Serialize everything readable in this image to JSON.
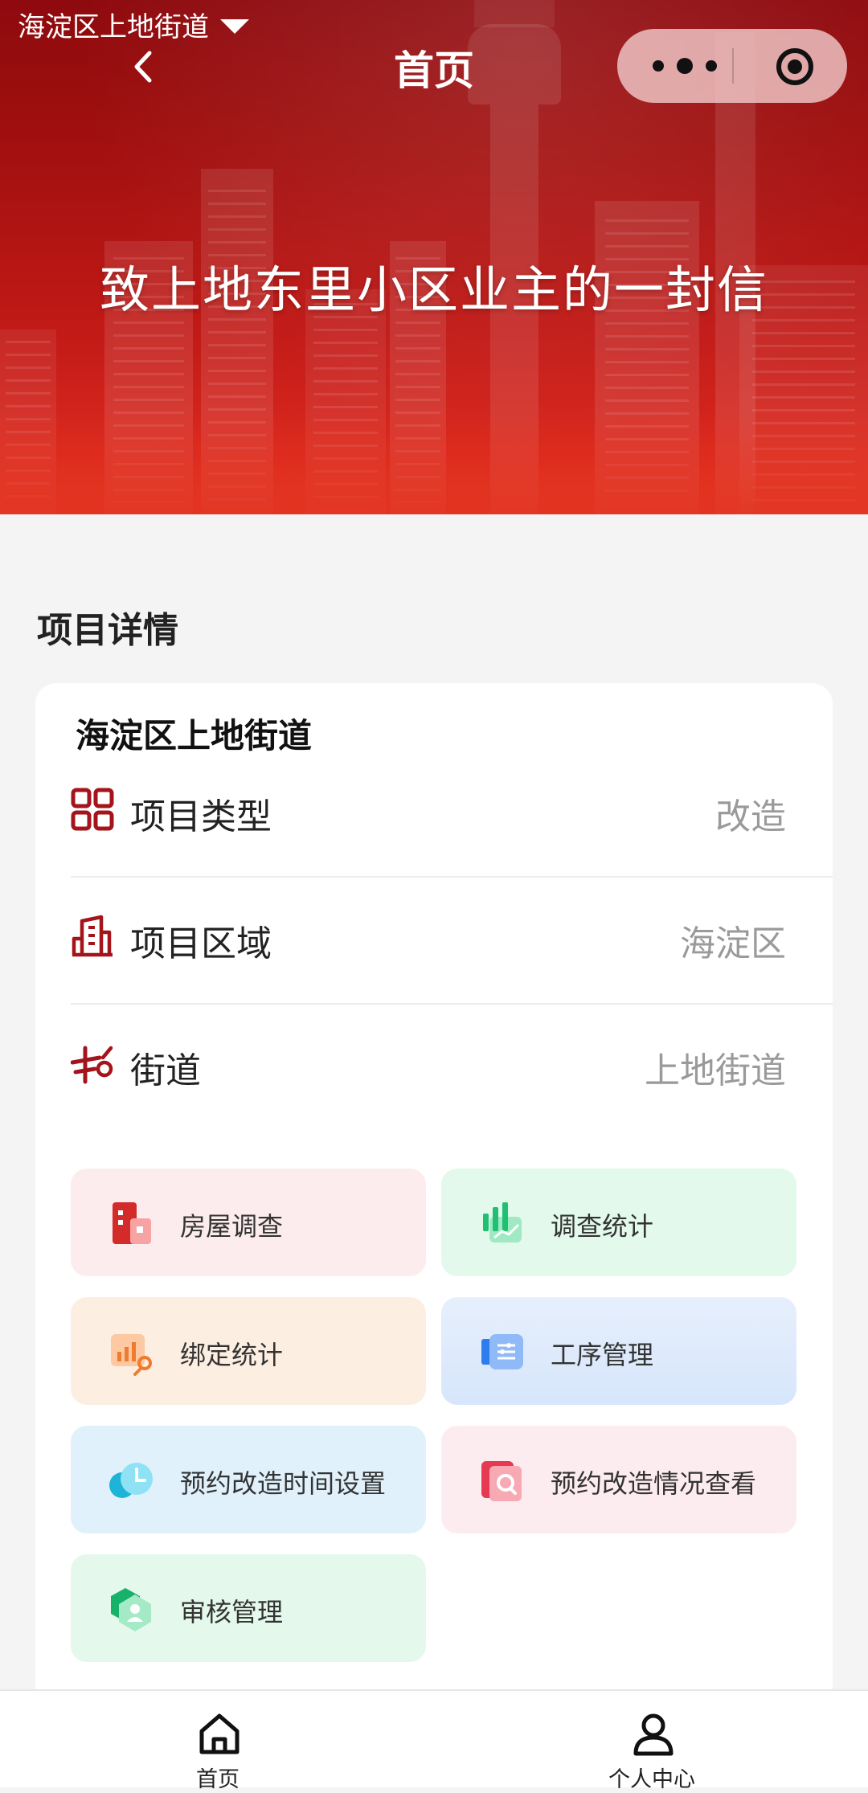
{
  "status": {
    "location": "海淀区上地街道"
  },
  "nav": {
    "title": "首页"
  },
  "hero": {
    "headline": "致上地东里小区业主的一封信"
  },
  "section": {
    "title": "项目详情"
  },
  "card": {
    "title": "海淀区上地街道",
    "rows": [
      {
        "icon": "grid-icon",
        "label": "项目类型",
        "value": "改造"
      },
      {
        "icon": "building-icon",
        "label": "项目区域",
        "value": "海淀区"
      },
      {
        "icon": "road-sign-icon",
        "label": "街道",
        "value": "上地街道"
      }
    ]
  },
  "tiles": [
    {
      "label": "房屋调查",
      "icon": "house-survey-icon",
      "bg": "#fdeced",
      "accent": "#d32a2a"
    },
    {
      "label": "调查统计",
      "icon": "bar-stats-icon",
      "bg": "#e2f9ec",
      "accent": "#1fbf74"
    },
    {
      "label": "绑定统计",
      "icon": "link-stats-icon",
      "bg": "#fdeee2",
      "accent": "#f07b2e"
    },
    {
      "label": "工序管理",
      "icon": "process-icon",
      "bg": "#dfeafb",
      "accent": "#2f7bf0"
    },
    {
      "label": "预约改造时间设置",
      "icon": "clock-icon",
      "bg": "#e0f1fb",
      "accent": "#1eb4d8"
    },
    {
      "label": "预约改造情况查看",
      "icon": "search-doc-icon",
      "bg": "#fdecef",
      "accent": "#e53a52"
    },
    {
      "label": "审核管理",
      "icon": "audit-user-icon",
      "bg": "#e4f8ec",
      "accent": "#17b26a"
    }
  ],
  "tabbar": [
    {
      "label": "首页",
      "icon": "home-icon"
    },
    {
      "label": "个人中心",
      "icon": "user-icon"
    }
  ],
  "colors": {
    "brand": "#c21a17",
    "icon_red": "#a4141b",
    "value_gray": "#9a9a9a"
  }
}
